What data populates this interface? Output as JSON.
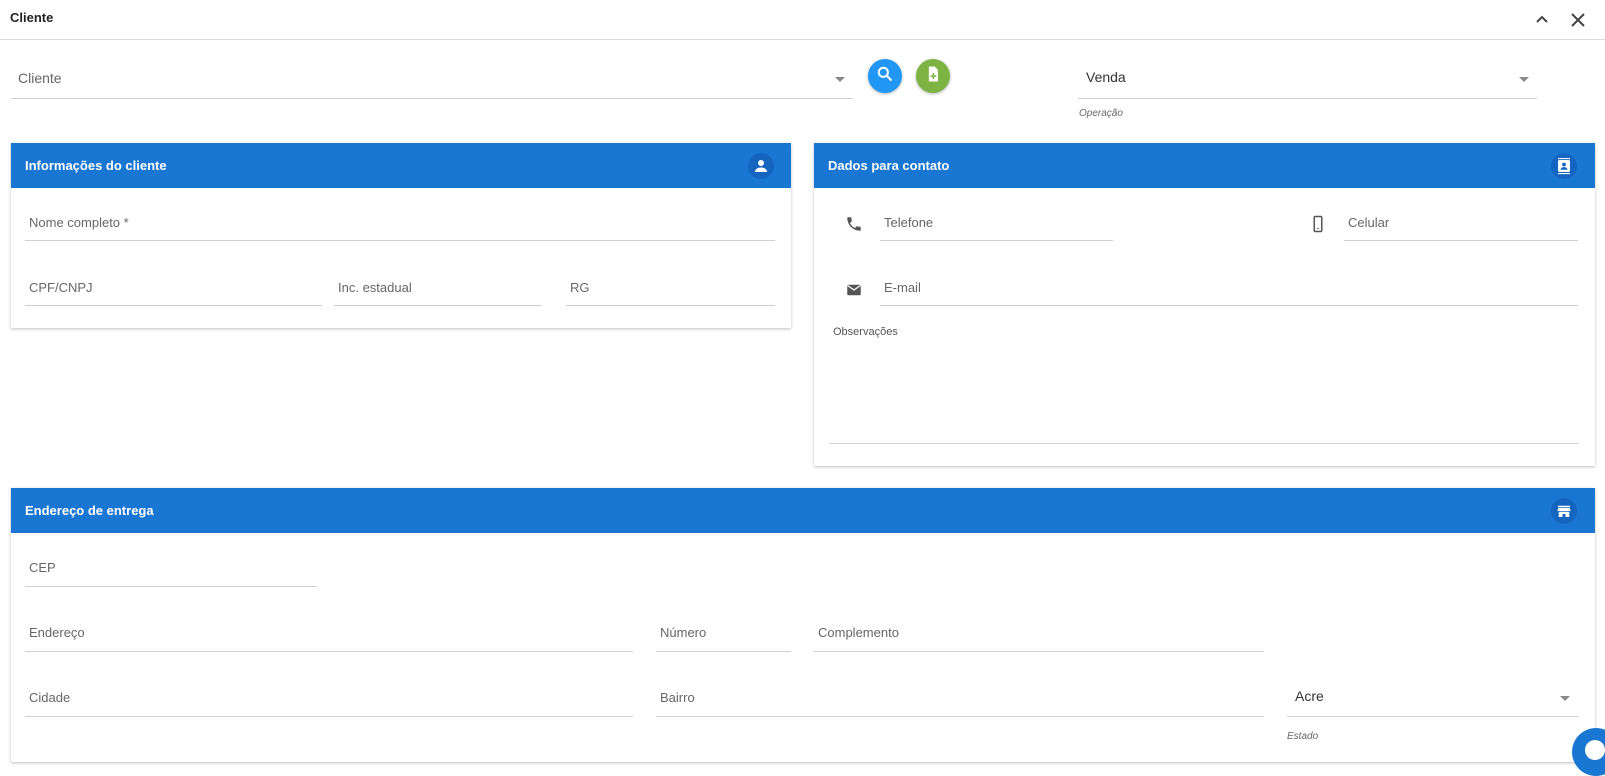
{
  "window": {
    "title": "Cliente",
    "collapse_icon": "chevron-up-icon",
    "close_icon": "close-icon"
  },
  "top": {
    "cliente_placeholder": "Cliente",
    "search_icon": "search-icon",
    "new_icon": "new-document-icon",
    "operacao_value": "Venda",
    "operacao_hint": "Operação"
  },
  "client_info": {
    "title": "Informações do cliente",
    "icon": "person-icon",
    "nome_label": "Nome completo *",
    "cpf_label": "CPF/CNPJ",
    "inc_label": "Inc. estadual",
    "rg_label": "RG"
  },
  "contact": {
    "title": "Dados para contato",
    "icon": "contact-card-icon",
    "telefone_label": "Telefone",
    "celular_label": "Celular",
    "email_label": "E-mail",
    "observacoes_label": "Observações"
  },
  "address": {
    "title": "Endereço de entrega",
    "icon": "store-icon",
    "cep_label": "CEP",
    "endereco_label": "Endereço",
    "numero_label": "Número",
    "complemento_label": "Complemento",
    "cidade_label": "Cidade",
    "bairro_label": "Bairro",
    "estado_value": "Acre",
    "estado_hint": "Estado"
  },
  "colors": {
    "header_blue": "#1976d2",
    "search_button": "#2196f3",
    "new_button": "#7cb342"
  }
}
